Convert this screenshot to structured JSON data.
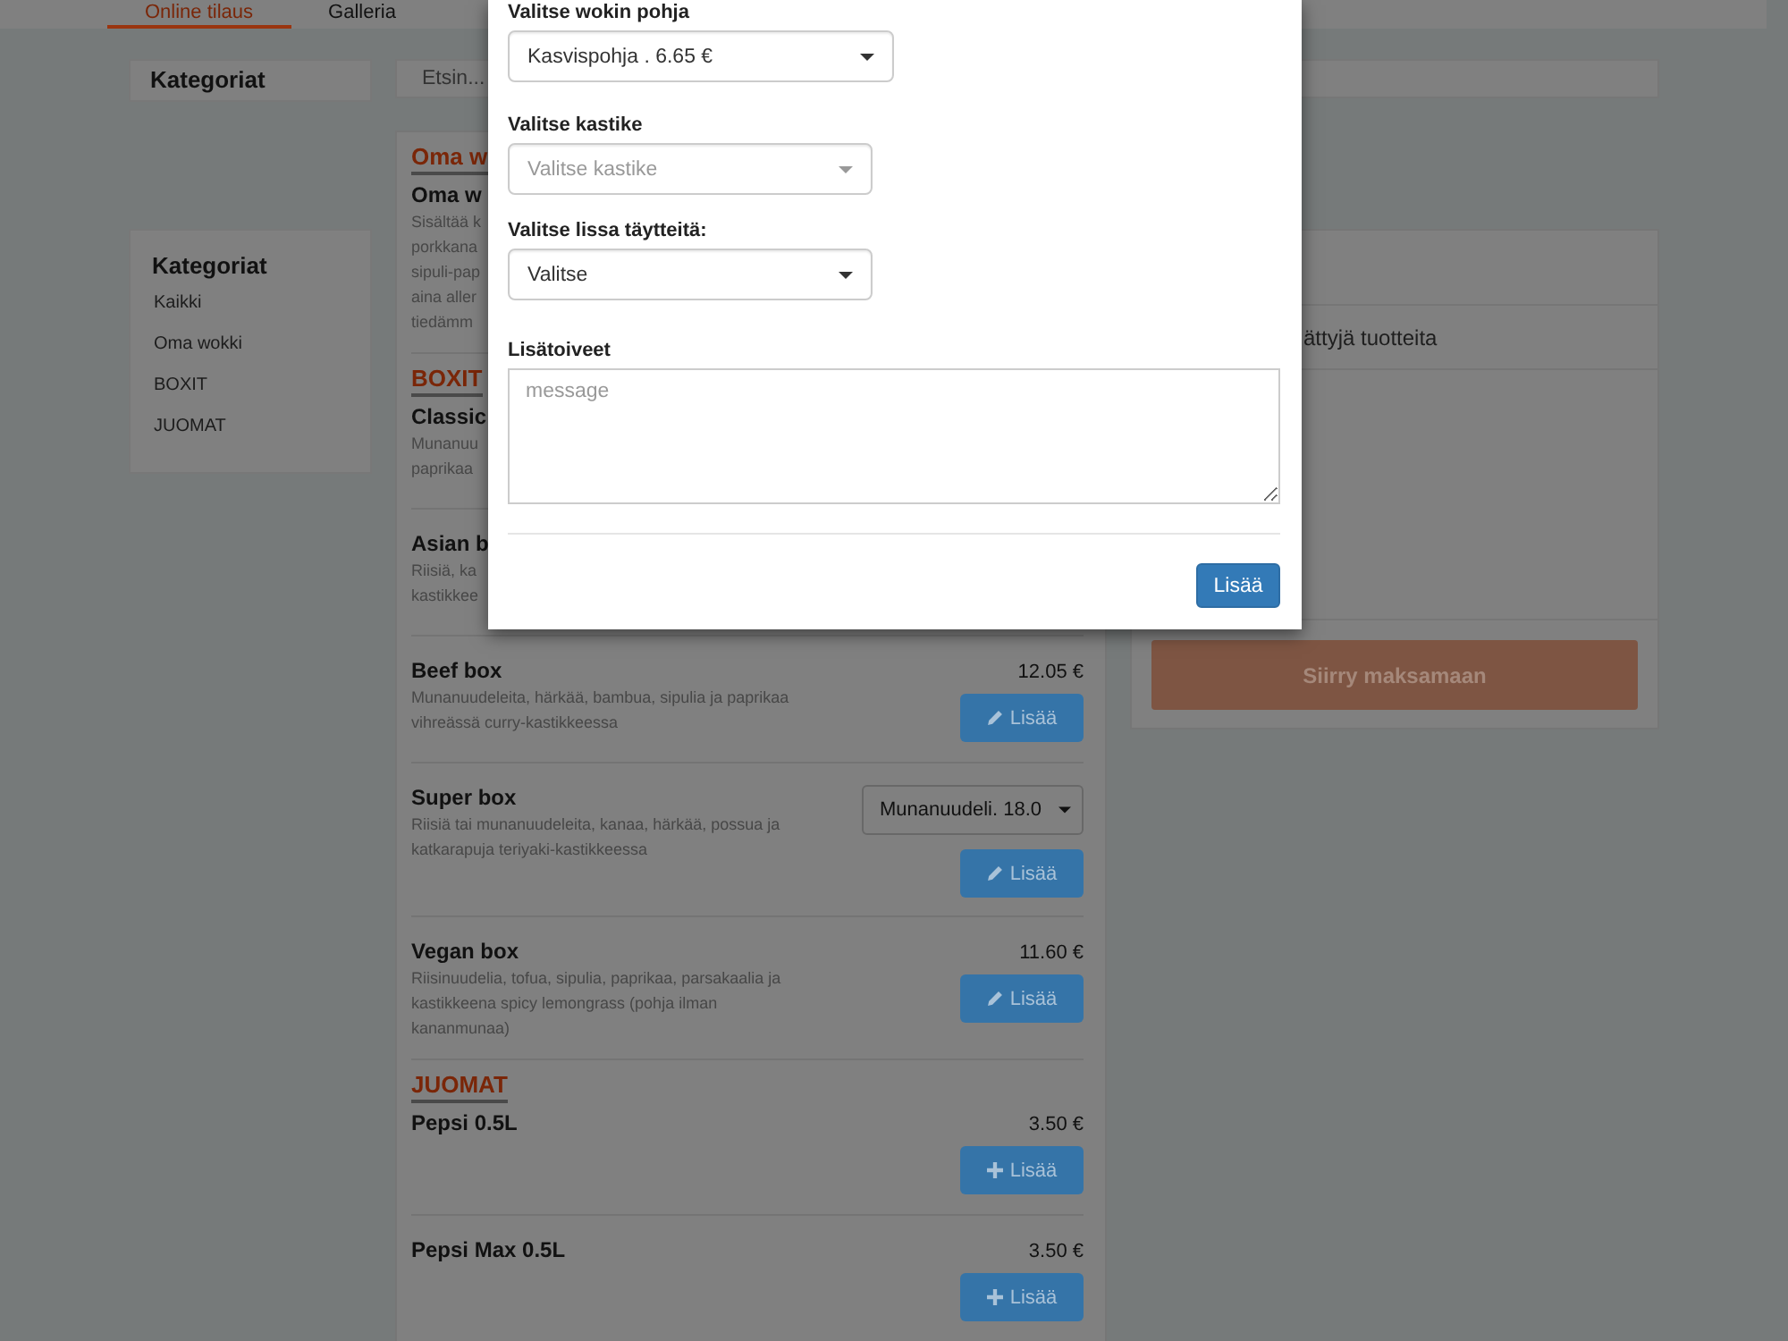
{
  "nav": {
    "tabs": [
      {
        "label": "Online tilaus",
        "selected": true
      },
      {
        "label": "Galleria",
        "selected": false
      }
    ]
  },
  "sidebar": {
    "header_title": "Kategoriat",
    "title": "Kategoriat",
    "items": [
      "Kaikki",
      "Oma wokki",
      "BOXIT",
      "JUOMAT"
    ]
  },
  "search": {
    "placeholder": "Etsin..."
  },
  "menu": {
    "sections": [
      {
        "heading": "Oma w",
        "items": [
          {
            "name": "Oma w",
            "description": [
              "Sisältää k",
              "porkkana",
              "sipuli-pap",
              "aina aller",
              "tiedämm"
            ]
          }
        ]
      },
      {
        "heading": "BOXIT",
        "items": [
          {
            "name": "Classic",
            "description": [
              "Munanuu",
              "paprikaa"
            ]
          },
          {
            "name": "Asian b",
            "description": [
              "Riisiä, ka",
              "kastikkee"
            ]
          },
          {
            "name": "Beef box",
            "description": [
              "Munanuudeleita, härkää, bambua, sipulia ja paprikaa vihreässä curry-kastikkeessa"
            ],
            "price": "12.05 €",
            "button": {
              "kind": "edit",
              "label": "Lisää"
            }
          },
          {
            "name": "Super box",
            "description": [
              "Riisiä tai munanuudeleita, kanaa, härkää, possua ja katkarapuja teriyaki-kastikkeessa"
            ],
            "option": "Munanuudeli. 18.0",
            "button": {
              "kind": "edit",
              "label": "Lisää"
            }
          },
          {
            "name": "Vegan box",
            "description": [
              "Riisinuudelia, tofua, sipulia, paprikaa, parsakaalia ja kastikkeena spicy lemongrass (pohja ilman kananmunaa)"
            ],
            "price": "11.60 €",
            "button": {
              "kind": "edit",
              "label": "Lisää"
            }
          }
        ]
      },
      {
        "heading": "JUOMAT",
        "items": [
          {
            "name": "Pepsi 0.5L",
            "price": "3.50 €",
            "button": {
              "kind": "add",
              "label": "Lisää"
            }
          },
          {
            "name": "Pepsi Max 0.5L",
            "price": "3.50 €",
            "button": {
              "kind": "add",
              "label": "Lisää"
            }
          }
        ]
      }
    ]
  },
  "cart": {
    "empty_text": "ättyjä tuotteita",
    "checkout_button": {
      "label": "Siirry maksamaan",
      "disabled": true
    }
  },
  "modal": {
    "fields": [
      {
        "kind": "select",
        "label": "Valitse wokin pohja",
        "value": "Kasvispohja . 6.65 €"
      },
      {
        "kind": "select",
        "label": "Valitse kastike",
        "placeholder": "Valitse kastike"
      },
      {
        "kind": "select",
        "label": "Valitse lissa täytteitä:",
        "value": "Valitse"
      },
      {
        "kind": "textarea",
        "label": "Lisätoiveet",
        "placeholder": "message"
      }
    ],
    "submit": "Lisää"
  }
}
